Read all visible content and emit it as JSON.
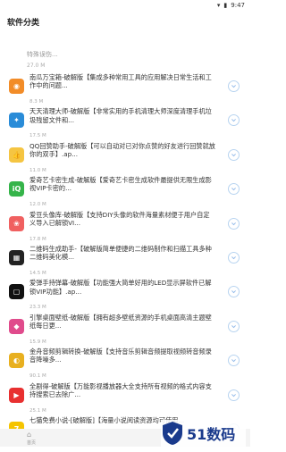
{
  "status": {
    "time": "9:47"
  },
  "app_bar": {
    "title": "软件分类"
  },
  "partial_top": {
    "title": "特殊误伤...",
    "size": "27.0 M"
  },
  "items": [
    {
      "title": "南瓜万宝箱-破解版【集成多种常用工具的应用解决日常生活和工作中的问题...",
      "size": "8.3 M",
      "icon_color": "#f28c28",
      "icon_glyph": "◉"
    },
    {
      "title": "天天清理大师-破解版【非常实用的手机清理大师深度清理手机垃圾残留文件和...",
      "size": "17.5 M",
      "icon_color": "#2a8cd8",
      "icon_glyph": "✦"
    },
    {
      "title": "QQ回赞助手-破解版【可以自动对已对你点赞的好友进行回赞就放你的双手】.ap...",
      "size": "11.0 M",
      "icon_color": "#f5c542",
      "icon_glyph": "👍"
    },
    {
      "title": "爱奇艺卡密生成-破解版【爱奇艺卡密生成软件最提供无限生成影视VIP卡密的...",
      "size": "12.0 M",
      "icon_color": "#35b44a",
      "icon_glyph": "iQ"
    },
    {
      "title": "爱豆头像库-破解版【支持DIY头像的软件海量素材便于用户自定义导入已解锁VI...",
      "size": "17.8 M",
      "icon_color": "#f06060",
      "icon_glyph": "❀"
    },
    {
      "title": "二维码生成助手-【破解版简单便捷的二维码制作和扫描工具多种二维码美化模...",
      "size": "14.5 M",
      "icon_color": "#222222",
      "icon_glyph": "▦"
    },
    {
      "title": "爱弹手持弹幕-破解版【功能强大简单好用的LED显示屏软件已解锁VIP功能】.ap...",
      "size": "23.3 M",
      "icon_color": "#111111",
      "icon_glyph": "▢"
    },
    {
      "title": "引擎桌面壁纸-破解版【拥有超多壁纸资源的手机桌面高清主题壁纸每日更...",
      "size": "15.9 M",
      "icon_color": "#e04b8c",
      "icon_glyph": "◆"
    },
    {
      "title": "金舟音频剪辑转换-破解版【支持音乐剪辑音频提取视频转音频录音降噪多...",
      "size": "90.1 M",
      "icon_color": "#e8b020",
      "icon_glyph": "◐"
    },
    {
      "title": "全剧得-破解版【万能影视播放器大全支持所有视频的格式内容支持搜索已去除广...",
      "size": "25.1 M",
      "icon_color": "#e83030",
      "icon_glyph": "▶"
    },
    {
      "title": "七猫免费小说-[破解版]【海量小说阅读资源均可使用...",
      "size": "",
      "icon_color": "#f5c400",
      "icon_glyph": "7"
    }
  ],
  "bottom_nav": {
    "home_label": "首页"
  },
  "watermark": {
    "text": "51数码"
  }
}
